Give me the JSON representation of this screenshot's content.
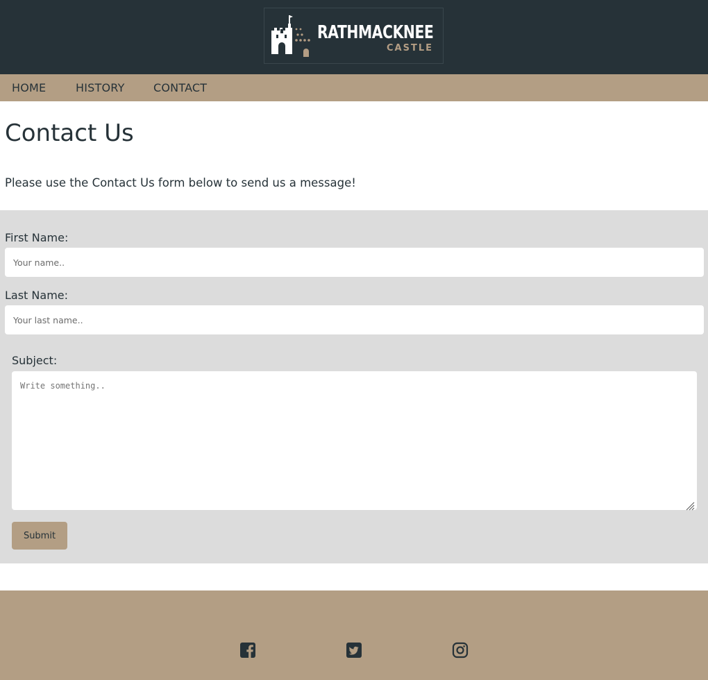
{
  "header": {
    "logo": {
      "title": "RATHMACKNEE",
      "subtitle": "CASTLE"
    }
  },
  "nav": {
    "items": [
      {
        "label": "HOME"
      },
      {
        "label": "HISTORY"
      },
      {
        "label": "CONTACT"
      }
    ]
  },
  "main": {
    "title": "Contact Us",
    "intro": "Please use the Contact Us form below to send us a message!"
  },
  "form": {
    "first_name": {
      "label": "First Name:",
      "placeholder": "Your name..",
      "value": ""
    },
    "last_name": {
      "label": "Last Name:",
      "placeholder": "Your last name..",
      "value": ""
    },
    "subject": {
      "label": "Subject:",
      "placeholder": "Write something..",
      "value": ""
    },
    "submit_label": "Submit"
  },
  "footer": {
    "social": [
      "facebook-icon",
      "twitter-icon",
      "instagram-icon"
    ]
  },
  "colors": {
    "header_bg": "#263238",
    "accent": "#b39e84",
    "form_bg": "#dcdcdc",
    "text": "#263238"
  }
}
